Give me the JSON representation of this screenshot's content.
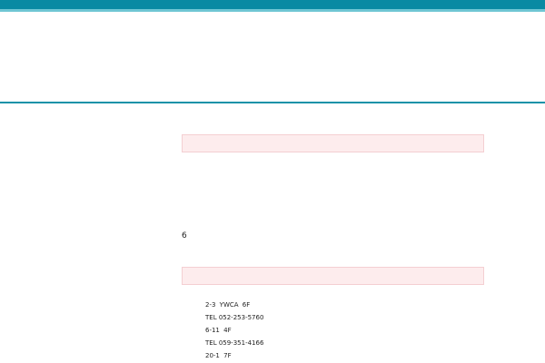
{
  "topbar": {
    "text": ""
  },
  "main": {
    "title": "",
    "section1": {
      "heading": "",
      "paragraphs": [
        "",
        "",
        "",
        "",
        "",
        "6"
      ]
    },
    "section2": {
      "heading": "",
      "contact_title": "",
      "rows": [
        {
          "label": "",
          "address_num": "2-3",
          "address_tail": "YWCA",
          "floor": "6F"
        },
        {
          "label": "",
          "tel": "TEL 052-253-5760"
        },
        {
          "label": "",
          "address_num": "6-11",
          "floor": "4F"
        },
        {
          "label": "",
          "tel": "TEL 059-351-4166"
        },
        {
          "label": "",
          "address_num": "20-1",
          "floor": "7F"
        }
      ]
    }
  },
  "colors": {
    "topbar": "#0a8aa3",
    "topbar_stripe": "#6fc6d4",
    "header_line": "#1592a8",
    "section_bg": "#fdeced",
    "section_border": "#f4cfd2"
  }
}
